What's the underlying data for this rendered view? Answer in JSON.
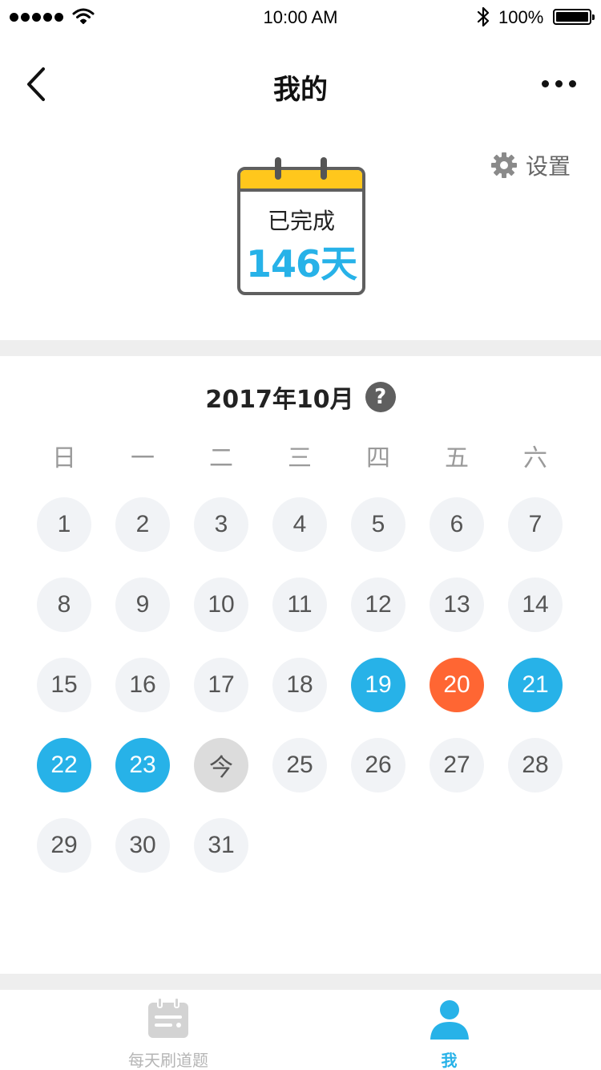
{
  "status_bar": {
    "time": "10:00 AM",
    "battery": "100%"
  },
  "nav": {
    "title": "我的",
    "back_icon": "chevron-left-icon",
    "more_icon": "more-dots-icon"
  },
  "settings": {
    "label": "设置",
    "icon": "gear-icon"
  },
  "summary": {
    "label": "已完成",
    "days": "146天"
  },
  "calendar": {
    "month_title": "2017年10月",
    "help_label": "?",
    "weekdays": [
      "日",
      "一",
      "二",
      "三",
      "四",
      "五",
      "六"
    ],
    "first_weekday_index": 0,
    "days": [
      {
        "label": "1",
        "state": "normal"
      },
      {
        "label": "2",
        "state": "normal"
      },
      {
        "label": "3",
        "state": "normal"
      },
      {
        "label": "4",
        "state": "normal"
      },
      {
        "label": "5",
        "state": "normal"
      },
      {
        "label": "6",
        "state": "normal"
      },
      {
        "label": "7",
        "state": "normal"
      },
      {
        "label": "8",
        "state": "normal"
      },
      {
        "label": "9",
        "state": "normal"
      },
      {
        "label": "10",
        "state": "normal"
      },
      {
        "label": "11",
        "state": "normal"
      },
      {
        "label": "12",
        "state": "normal"
      },
      {
        "label": "13",
        "state": "normal"
      },
      {
        "label": "14",
        "state": "normal"
      },
      {
        "label": "15",
        "state": "normal"
      },
      {
        "label": "16",
        "state": "normal"
      },
      {
        "label": "17",
        "state": "normal"
      },
      {
        "label": "18",
        "state": "normal"
      },
      {
        "label": "19",
        "state": "done"
      },
      {
        "label": "20",
        "state": "missed"
      },
      {
        "label": "21",
        "state": "done"
      },
      {
        "label": "22",
        "state": "done"
      },
      {
        "label": "23",
        "state": "done"
      },
      {
        "label": "今",
        "state": "today"
      },
      {
        "label": "25",
        "state": "normal"
      },
      {
        "label": "26",
        "state": "normal"
      },
      {
        "label": "27",
        "state": "normal"
      },
      {
        "label": "28",
        "state": "normal"
      },
      {
        "label": "29",
        "state": "normal"
      },
      {
        "label": "30",
        "state": "normal"
      },
      {
        "label": "31",
        "state": "normal"
      }
    ]
  },
  "colors": {
    "accent": "#27b2e8",
    "missed": "#ff6633",
    "header_yellow": "#ffc71c"
  },
  "tabs": [
    {
      "label": "每天刷道题",
      "icon": "daily-question-icon",
      "active": false
    },
    {
      "label": "我",
      "icon": "user-icon",
      "active": true
    }
  ]
}
